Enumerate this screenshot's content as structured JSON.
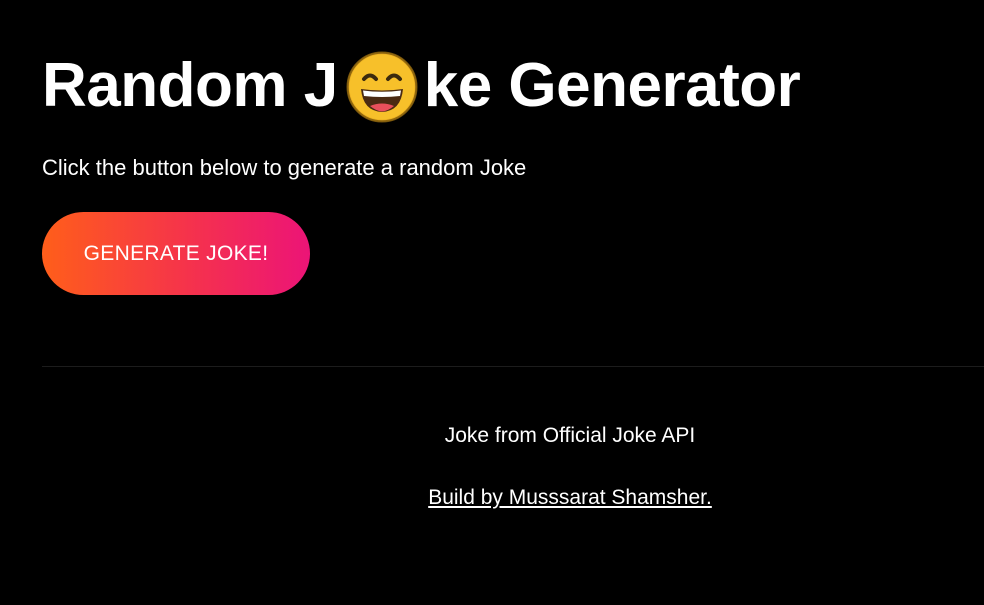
{
  "header": {
    "title_before": "Random J",
    "title_after": "ke Generator",
    "title_icon": "grinning-face-emoji"
  },
  "main": {
    "subtitle": "Click the button below to generate a random Joke",
    "generate_button_label": "GENERATE JOKE!"
  },
  "footer": {
    "source_note": "Joke from Official Joke API",
    "credit_link": "Build by Musssarat Shamsher."
  },
  "colors": {
    "background": "#000000",
    "text": "#ffffff",
    "button_gradient_start": "#ff5e1a",
    "button_gradient_end": "#ec1477",
    "emoji_face": "#f7c02a"
  }
}
